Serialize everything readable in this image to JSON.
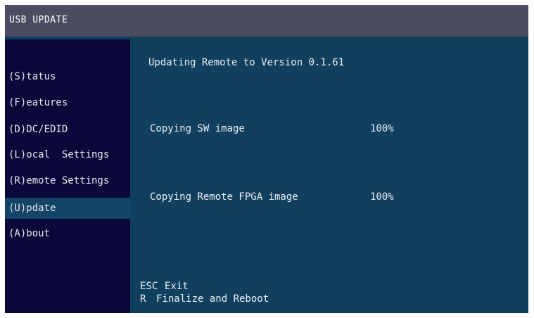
{
  "window": {
    "title": "USB UPDATE"
  },
  "sidebar": {
    "items": [
      {
        "label": "(S)tatus",
        "active": false
      },
      {
        "label": "(F)eatures",
        "active": false
      },
      {
        "label": "(D)DC/EDID",
        "active": false
      },
      {
        "label": "(L)ocal  Settings",
        "active": false
      },
      {
        "label": "(R)emote Settings",
        "active": false
      },
      {
        "label": "(U)pdate",
        "active": true
      },
      {
        "label": "(A)bout",
        "active": false
      }
    ]
  },
  "main": {
    "heading": "Updating Remote to Version 0.1.61",
    "progress": [
      {
        "label": "Copying SW image",
        "value": "100%",
        "percent": 100
      },
      {
        "label": "Copying Remote FPGA image",
        "value": "100%",
        "percent": 100
      }
    ]
  },
  "footer": {
    "hints": [
      {
        "key": "ESC",
        "text": "Exit"
      },
      {
        "key": "R",
        "text": "Finalize and Reboot"
      }
    ]
  },
  "colors": {
    "title_bar": "#4b4c61",
    "background": "#11405f",
    "sidebar": "#090839",
    "active_item": "#134467",
    "text": "#e9eef4"
  }
}
